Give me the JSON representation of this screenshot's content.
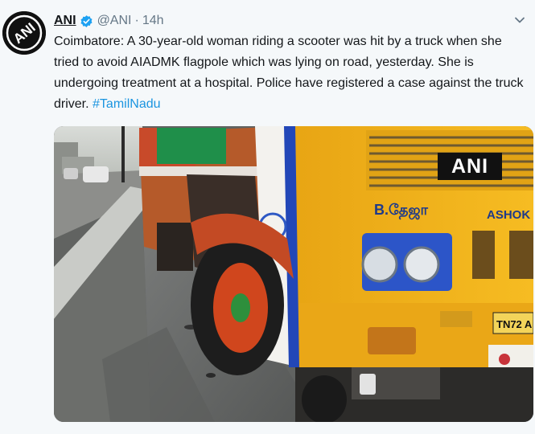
{
  "tweet": {
    "name": "ANI",
    "handle": "@ANI",
    "separator": "·",
    "time": "14h",
    "text": "Coimbatore: A 30-year-old woman riding a scooter was hit by a truck when she tried to avoid AIADMK flagpole which was lying on road, yesterday. She is undergoing treatment at a hospital. Police have registered a case against the truck driver.",
    "hashtag": "#TamilNadu"
  },
  "avatar": {
    "logo_text": "ANI"
  },
  "media": {
    "watermark": "ANI",
    "truck_sign_left": "B.தேஜா",
    "truck_brand": "ASHOK",
    "plate": "TN72 A"
  },
  "colors": {
    "accent": "#1b95e0",
    "truck_yellow": "#f2b21a",
    "truck_blue": "#1f4fbf"
  }
}
